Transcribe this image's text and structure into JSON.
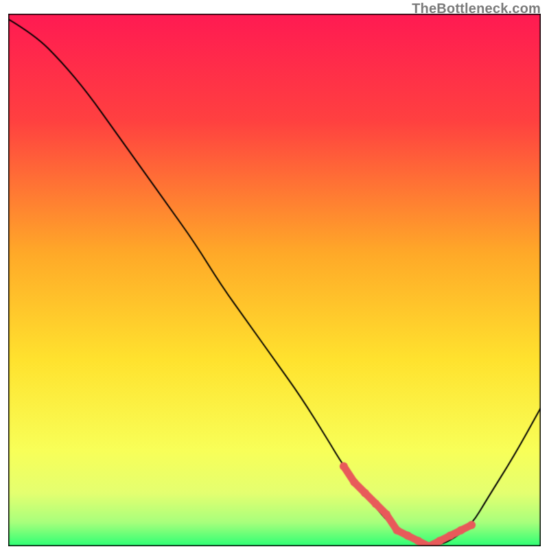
{
  "watermark": "TheBottleneck.com",
  "chart_data": {
    "type": "line",
    "title": "",
    "xlabel": "",
    "ylabel": "",
    "xlim": [
      0,
      100
    ],
    "ylim": [
      0,
      100
    ],
    "grid": false,
    "legend": false,
    "background_gradient_stops": [
      {
        "pos": 0.0,
        "color": "#ff1a52"
      },
      {
        "pos": 0.2,
        "color": "#ff4040"
      },
      {
        "pos": 0.45,
        "color": "#ffa928"
      },
      {
        "pos": 0.65,
        "color": "#ffe22e"
      },
      {
        "pos": 0.82,
        "color": "#f8ff58"
      },
      {
        "pos": 0.9,
        "color": "#e4ff70"
      },
      {
        "pos": 0.955,
        "color": "#a8ff7c"
      },
      {
        "pos": 1.0,
        "color": "#2bff74"
      }
    ],
    "series": [
      {
        "name": "bottleneck-curve",
        "color": "#000000",
        "width": 2,
        "x": [
          0,
          5,
          10,
          15,
          20,
          25,
          30,
          35,
          40,
          45,
          50,
          55,
          60,
          63,
          67,
          70,
          73,
          77,
          80,
          83,
          87,
          90,
          95,
          100
        ],
        "y": [
          99,
          96,
          91,
          85,
          78,
          71,
          64,
          57,
          49,
          42,
          35,
          28,
          20,
          15,
          10,
          6,
          3,
          1,
          0,
          1,
          4,
          9,
          17,
          26
        ]
      }
    ],
    "markers": {
      "name": "valley-dots",
      "color": "#e85a5a",
      "radius": 6,
      "x": [
        63,
        65,
        67,
        69,
        71,
        73,
        75,
        77,
        79,
        81,
        83,
        85,
        87
      ],
      "y": [
        15,
        12,
        10,
        8,
        6,
        3,
        2,
        1,
        0,
        1,
        2,
        3,
        4
      ]
    }
  }
}
